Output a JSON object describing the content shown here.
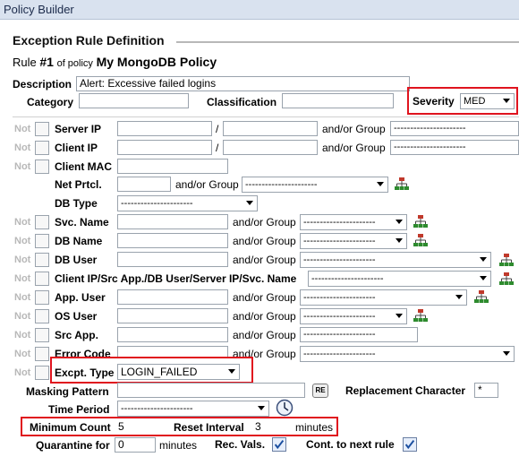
{
  "window": {
    "title": "Policy Builder"
  },
  "section": {
    "title": "Exception Rule Definition"
  },
  "rule": {
    "prefix": "Rule",
    "number": "#1",
    "of_policy": "of policy",
    "policy_name": "My MongoDB Policy"
  },
  "description": {
    "label": "Description",
    "value": "Alert: Excessive failed logins"
  },
  "category": {
    "label": "Category",
    "value": ""
  },
  "classification": {
    "label": "Classification",
    "value": ""
  },
  "severity": {
    "label": "Severity",
    "value": "MED"
  },
  "not_label": "Not",
  "slash": "/",
  "and_or_group": "and/or Group",
  "dashes": "----------------------",
  "fields": {
    "server_ip": "Server IP",
    "client_ip": "Client IP",
    "client_mac": "Client MAC",
    "net_prtcl": "Net Prtcl.",
    "db_type": "DB Type",
    "svc_name": "Svc. Name",
    "db_name": "DB Name",
    "db_user": "DB User",
    "client_combo": "Client IP/Src App./DB User/Server IP/Svc. Name",
    "app_user": "App. User",
    "os_user": "OS User",
    "src_app": "Src App.",
    "error_code": "Error Code",
    "excpt_type": "Excpt. Type"
  },
  "excpt_type_value": "LOGIN_FAILED",
  "masking": {
    "label": "Masking Pattern",
    "value": "",
    "re_button": "RE"
  },
  "replacement": {
    "label": "Replacement Character",
    "value": "*"
  },
  "time_period": {
    "label": "Time Period",
    "value": "----------------------"
  },
  "min_count": {
    "label": "Minimum Count",
    "value": "5"
  },
  "reset_interval": {
    "label": "Reset Interval",
    "value": "3",
    "unit": "minutes"
  },
  "quarantine": {
    "label": "Quarantine for",
    "value": "0",
    "unit": "minutes"
  },
  "rec_vals": {
    "label": "Rec. Vals.",
    "checked": true
  },
  "cont_next": {
    "label": "Cont. to next rule",
    "checked": true
  },
  "colors": {
    "highlight": "#e0141e",
    "titlebar": "#d9e2ef",
    "tree_icon": "#c0392b"
  }
}
